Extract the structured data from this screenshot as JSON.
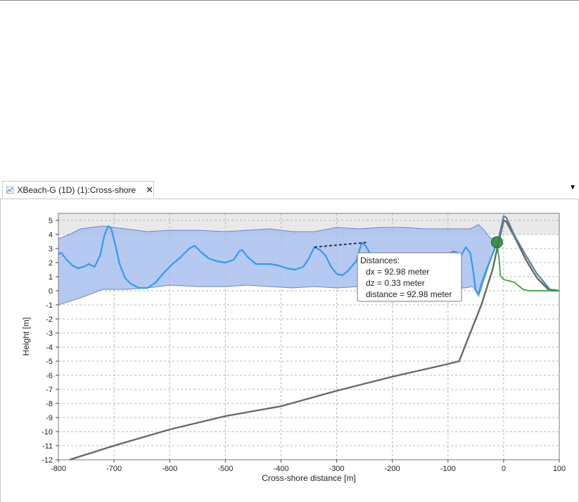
{
  "tab": {
    "title": "XBeach-G (1D) (1):Cross-shore",
    "close_glyph": "✕",
    "menu_glyph": "▼",
    "icon": "chart-icon"
  },
  "colors": {
    "band_fill": "#a9bfee",
    "band_stroke": "#6f86cf",
    "wave_line": "#2f9cf0",
    "bed_line": "#5f6f5c",
    "green_line": "#3aa43a",
    "dune_line": "#5f7ea8",
    "marker": "#2e8b3e",
    "plot_bg_upper": "#e9e9e9"
  },
  "tooltip": {
    "title": "Distances:",
    "dx": "dx = 92.98 meter",
    "dz": "dz = 0.33 meter",
    "distance": "distance = 92.98 meter"
  },
  "chart_data": {
    "type": "line",
    "xlabel": "Cross-shore distance [m]",
    "ylabel": "Height [m]",
    "xlim": [
      -800,
      100
    ],
    "ylim": [
      -12,
      5.5
    ],
    "xticks": [
      -800,
      -700,
      -600,
      -500,
      -400,
      -300,
      -200,
      -100,
      0,
      100
    ],
    "yticks": [
      5,
      4,
      3,
      2,
      1,
      0,
      -1,
      -2,
      -3,
      -4,
      -5,
      -6,
      -7,
      -8,
      -9,
      -10,
      -11,
      -12
    ],
    "grid": true,
    "series": [
      {
        "kind": "band",
        "upper": [
          [
            -800,
            3.7
          ],
          [
            -780,
            4.0
          ],
          [
            -760,
            4.4
          ],
          [
            -720,
            4.6
          ],
          [
            -680,
            4.4
          ],
          [
            -640,
            4.2
          ],
          [
            -600,
            4.3
          ],
          [
            -550,
            4.3
          ],
          [
            -500,
            4.2
          ],
          [
            -460,
            4.3
          ],
          [
            -420,
            4.4
          ],
          [
            -380,
            4.2
          ],
          [
            -340,
            4.2
          ],
          [
            -300,
            4.5
          ],
          [
            -260,
            4.4
          ],
          [
            -220,
            4.5
          ],
          [
            -180,
            4.5
          ],
          [
            -140,
            4.4
          ],
          [
            -100,
            4.4
          ],
          [
            -60,
            4.4
          ],
          [
            -45,
            4.7
          ],
          [
            -35,
            4.3
          ],
          [
            -25,
            3.8
          ],
          [
            -15,
            3.6
          ]
        ],
        "lower": [
          [
            -800,
            -1.0
          ],
          [
            -760,
            -0.5
          ],
          [
            -720,
            0.1
          ],
          [
            -680,
            0.1
          ],
          [
            -640,
            0.2
          ],
          [
            -600,
            0.4
          ],
          [
            -550,
            0.3
          ],
          [
            -500,
            0.3
          ],
          [
            -460,
            0.4
          ],
          [
            -420,
            0.3
          ],
          [
            -380,
            0.2
          ],
          [
            -340,
            0.3
          ],
          [
            -300,
            0.2
          ],
          [
            -260,
            0.3
          ],
          [
            -220,
            0.3
          ],
          [
            -180,
            0.2
          ],
          [
            -140,
            0.1
          ],
          [
            -100,
            0.2
          ],
          [
            -70,
            0.2
          ],
          [
            -55,
            0.3
          ],
          [
            -45,
            -0.4
          ],
          [
            -35,
            0.8
          ],
          [
            -25,
            2.0
          ],
          [
            -15,
            3.0
          ]
        ]
      },
      {
        "kind": "wave",
        "points": [
          [
            -800,
            2.6
          ],
          [
            -795,
            2.7
          ],
          [
            -785,
            2.2
          ],
          [
            -775,
            1.8
          ],
          [
            -765,
            1.6
          ],
          [
            -755,
            1.7
          ],
          [
            -745,
            1.9
          ],
          [
            -735,
            1.7
          ],
          [
            -725,
            2.5
          ],
          [
            -717,
            4.0
          ],
          [
            -710,
            4.6
          ],
          [
            -705,
            4.4
          ],
          [
            -698,
            3.3
          ],
          [
            -690,
            1.9
          ],
          [
            -680,
            0.9
          ],
          [
            -670,
            0.5
          ],
          [
            -655,
            0.2
          ],
          [
            -640,
            0.2
          ],
          [
            -625,
            0.6
          ],
          [
            -610,
            1.3
          ],
          [
            -595,
            1.9
          ],
          [
            -580,
            2.4
          ],
          [
            -565,
            3.0
          ],
          [
            -555,
            3.2
          ],
          [
            -545,
            2.8
          ],
          [
            -530,
            2.3
          ],
          [
            -515,
            2.1
          ],
          [
            -500,
            2.0
          ],
          [
            -485,
            2.2
          ],
          [
            -475,
            2.8
          ],
          [
            -470,
            2.9
          ],
          [
            -460,
            2.4
          ],
          [
            -445,
            1.9
          ],
          [
            -430,
            1.9
          ],
          [
            -420,
            1.9
          ],
          [
            -405,
            1.8
          ],
          [
            -390,
            1.6
          ],
          [
            -375,
            1.5
          ],
          [
            -360,
            1.7
          ],
          [
            -350,
            2.3
          ],
          [
            -340,
            3.1
          ],
          [
            -330,
            2.9
          ],
          [
            -320,
            2.5
          ],
          [
            -310,
            1.7
          ],
          [
            -300,
            1.2
          ],
          [
            -290,
            1.1
          ],
          [
            -280,
            1.4
          ],
          [
            -265,
            2.1
          ],
          [
            -255,
            3.4
          ],
          [
            -248,
            3.2
          ],
          [
            -235,
            2.3
          ],
          [
            -220,
            2.2
          ],
          [
            -200,
            2.3
          ],
          [
            -150,
            2.4
          ],
          [
            -100,
            2.6
          ],
          [
            -90,
            2.8
          ],
          [
            -75,
            2.6
          ],
          [
            -68,
            3.1
          ],
          [
            -60,
            2.7
          ],
          [
            -55,
            1.5
          ],
          [
            -50,
            0.0
          ],
          [
            -45,
            -0.2
          ],
          [
            -40,
            0.5
          ],
          [
            -30,
            1.6
          ],
          [
            -20,
            2.6
          ],
          [
            -12,
            3.4
          ]
        ]
      },
      {
        "kind": "bed",
        "points": [
          [
            -780,
            -12.0
          ],
          [
            -700,
            -11.0
          ],
          [
            -600,
            -9.85
          ],
          [
            -500,
            -8.9
          ],
          [
            -400,
            -8.2
          ],
          [
            -300,
            -7.1
          ],
          [
            -200,
            -6.1
          ],
          [
            -100,
            -5.2
          ],
          [
            -80,
            -5.0
          ],
          [
            -60,
            -3.0
          ],
          [
            -40,
            -1.0
          ],
          [
            -20,
            1.5
          ],
          [
            -10,
            3.3
          ],
          [
            0,
            5.0
          ],
          [
            5,
            4.9
          ],
          [
            20,
            3.8
          ],
          [
            40,
            2.2
          ],
          [
            60,
            0.9
          ],
          [
            80,
            0.1
          ],
          [
            100,
            0.0
          ]
        ]
      },
      {
        "kind": "dune",
        "points": [
          [
            -10,
            3.5
          ],
          [
            -5,
            4.4
          ],
          [
            0,
            5.3
          ],
          [
            5,
            5.2
          ],
          [
            20,
            3.9
          ],
          [
            40,
            2.5
          ],
          [
            60,
            1.2
          ],
          [
            85,
            0.0
          ],
          [
            100,
            0.0
          ]
        ]
      },
      {
        "kind": "green",
        "points": [
          [
            -12,
            3.4
          ],
          [
            -8,
            2.2
          ],
          [
            -6,
            1.1
          ],
          [
            0,
            0.8
          ],
          [
            10,
            0.7
          ],
          [
            20,
            0.6
          ],
          [
            25,
            0.4
          ],
          [
            35,
            0.1
          ],
          [
            45,
            0.0
          ],
          [
            100,
            0.0
          ]
        ]
      },
      {
        "kind": "measure",
        "points": [
          [
            -340,
            3.1
          ],
          [
            -247,
            3.43
          ]
        ]
      },
      {
        "kind": "marker",
        "points": [
          [
            -12,
            3.45
          ]
        ]
      }
    ]
  }
}
